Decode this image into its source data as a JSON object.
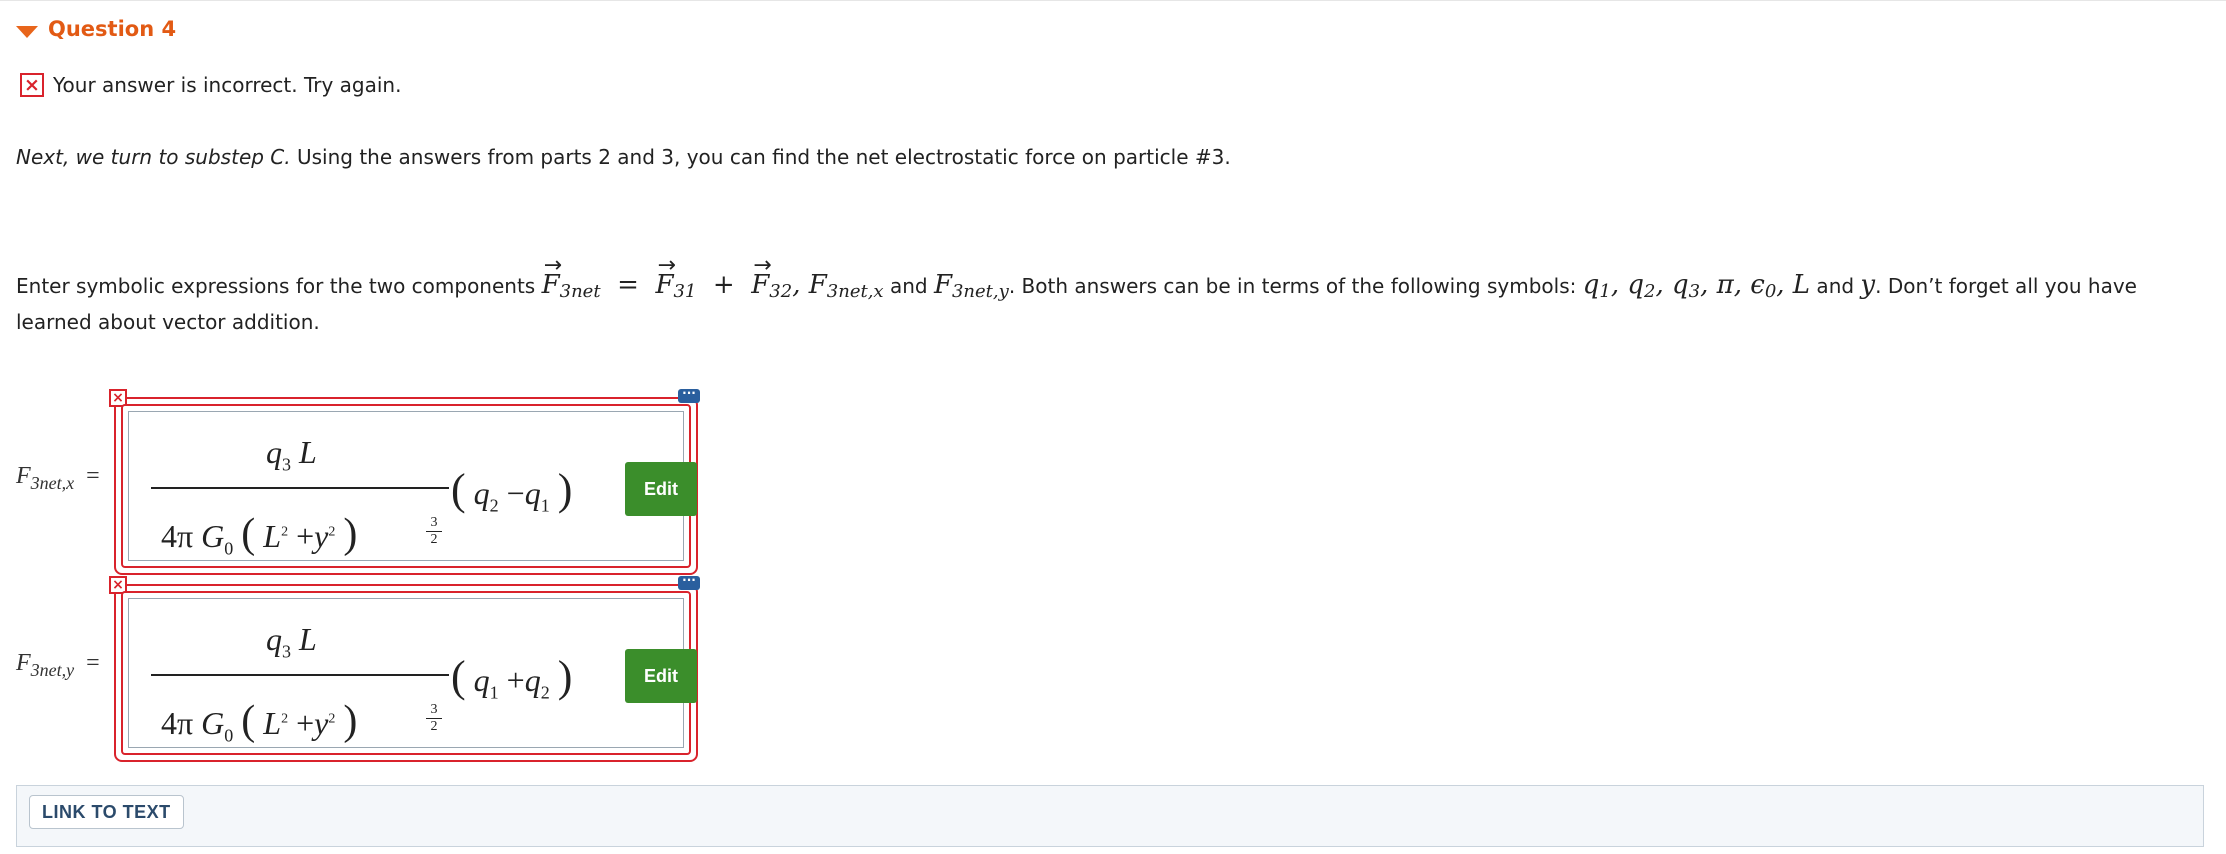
{
  "question": {
    "title": "Question 4"
  },
  "feedback": {
    "icon": "×",
    "text": "Your answer is incorrect.  Try again."
  },
  "intro": {
    "italic": "Next, we turn to substep C.",
    "text": " Using the answers from parts 2 and 3, you can find the net electrostatic force on particle #3."
  },
  "prompt": {
    "part1": "Enter symbolic expressions for the two components ",
    "and_word": " and ",
    "part2": ". Both answers can be in terms of the following symbols: ",
    "and_word2": " and ",
    "part3": ". Don’t forget all you have learned about vector addition."
  },
  "answers": [
    {
      "label_sub": "3net,x",
      "num_sub": "3",
      "num_var": "L",
      "den_const": "4π",
      "den_G": "G",
      "den_G_sub": "0",
      "den_L": "L",
      "den_y": "y",
      "exp_num": "3",
      "exp_den": "2",
      "trail_a": "q",
      "trail_a_sub": "2",
      "trail_op": "−",
      "trail_b": "q",
      "trail_b_sub": "1",
      "edit_label": "Edit"
    },
    {
      "label_sub": "3net,y",
      "num_sub": "3",
      "num_var": "L",
      "den_const": "4π",
      "den_G": "G",
      "den_G_sub": "0",
      "den_L": "L",
      "den_y": "y",
      "exp_num": "3",
      "exp_den": "2",
      "trail_a": "q",
      "trail_a_sub": "1",
      "trail_op": "+",
      "trail_b": "q",
      "trail_b_sub": "2",
      "edit_label": "Edit"
    }
  ],
  "footer": {
    "link_label": "LINK TO TEXT"
  },
  "colors": {
    "accent_orange": "#e25a14",
    "error_red": "#d9232c",
    "edit_green": "#3b8e2b",
    "dots_blue": "#2a5f9e"
  }
}
